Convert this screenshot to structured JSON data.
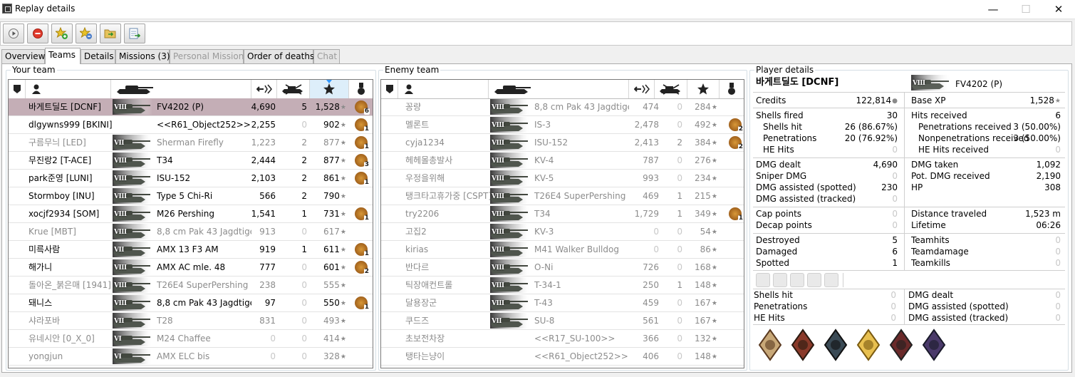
{
  "window": {
    "title": "Replay details",
    "minimize": "—",
    "maximize": "☐",
    "close": "✕"
  },
  "tabs": [
    {
      "label": "Overview",
      "state": "normal"
    },
    {
      "label": "Teams",
      "state": "active"
    },
    {
      "label": "Details",
      "state": "normal"
    },
    {
      "label": "Missions (3)",
      "state": "normal"
    },
    {
      "label": "Personal Mission",
      "state": "disabled"
    },
    {
      "label": "Order of deaths",
      "state": "normal"
    },
    {
      "label": "Chat",
      "state": "disabled"
    }
  ],
  "your_team": {
    "label": "Your team",
    "rows": [
      {
        "player": "바게트딜도 [DCNF]",
        "tier": "VIII",
        "tank": "FV4202 (P)",
        "dmg": "4,690",
        "kills": "5",
        "xp": "1,528",
        "medal": "6",
        "dim": false,
        "selected": true
      },
      {
        "player": "dlgywns999 [BKINI]",
        "tier": "",
        "tank": "<<R61_Object252>>",
        "dmg": "2,255",
        "kills": "0",
        "xp": "902",
        "medal": "1",
        "dim": false
      },
      {
        "player": "구름무늬 [LED]",
        "tier": "VII",
        "tank": "Sherman Firefly",
        "dmg": "1,223",
        "kills": "2",
        "xp": "877",
        "medal": "1",
        "dim": true
      },
      {
        "player": "무진랑2 [T-ACE]",
        "tier": "VIII",
        "tank": "T34",
        "dmg": "2,444",
        "kills": "2",
        "xp": "877",
        "medal": "3",
        "dim": false
      },
      {
        "player": "park준영 [LUNI]",
        "tier": "VIII",
        "tank": "ISU-152",
        "dmg": "2,103",
        "kills": "2",
        "xp": "861",
        "medal": "1",
        "dim": false
      },
      {
        "player": "Stormboy [INU]",
        "tier": "VIII",
        "tank": "Type 5 Chi-Ri",
        "dmg": "566",
        "kills": "2",
        "xp": "790",
        "medal": "",
        "dim": false
      },
      {
        "player": "xocjf2934 [SOM]",
        "tier": "VIII",
        "tank": "M26 Pershing",
        "dmg": "1,541",
        "kills": "1",
        "xp": "731",
        "medal": "1",
        "dim": false
      },
      {
        "player": "Krue [MBT]",
        "tier": "VIII",
        "tank": "8,8 cm Pak 43 Jagdtiger",
        "dmg": "913",
        "kills": "0",
        "xp": "617",
        "medal": "",
        "dim": true
      },
      {
        "player": "미륵사람",
        "tier": "VII",
        "tank": "AMX 13 F3 AM",
        "dmg": "919",
        "kills": "1",
        "xp": "611",
        "medal": "1",
        "dim": false
      },
      {
        "player": "해가니",
        "tier": "VIII",
        "tank": "AMX AC mle. 48",
        "dmg": "777",
        "kills": "0",
        "xp": "601",
        "medal": "2",
        "dim": false
      },
      {
        "player": "돌아온_붉은매 [1941]",
        "tier": "VIII",
        "tank": "T26E4 SuperPershing",
        "dmg": "238",
        "kills": "0",
        "xp": "555",
        "medal": "",
        "dim": true
      },
      {
        "player": "돼니스",
        "tier": "VIII",
        "tank": "8,8 cm Pak 43 Jagdtiger",
        "dmg": "97",
        "kills": "0",
        "xp": "550",
        "medal": "1",
        "dim": false
      },
      {
        "player": "샤라포바",
        "tier": "VII",
        "tank": "T28",
        "dmg": "831",
        "kills": "0",
        "xp": "493",
        "medal": "",
        "dim": true
      },
      {
        "player": "유네시안 [0_X_0]",
        "tier": "VI",
        "tank": "M24 Chaffee",
        "dmg": "0",
        "kills": "0",
        "xp": "414",
        "medal": "",
        "dim": true
      },
      {
        "player": "yongjun",
        "tier": "VI",
        "tank": "AMX ELC bis",
        "dmg": "0",
        "kills": "0",
        "xp": "328",
        "medal": "",
        "dim": true
      }
    ]
  },
  "enemy_team": {
    "label": "Enemy team",
    "rows": [
      {
        "player": "꽁량",
        "tier": "VIII",
        "tank": "8,8 cm Pak 43 Jagdtiger",
        "dmg": "474",
        "kills": "0",
        "xp": "284",
        "medal": "",
        "dim": true
      },
      {
        "player": "멜론트",
        "tier": "VIII",
        "tank": "IS-3",
        "dmg": "2,478",
        "kills": "0",
        "xp": "492",
        "medal": "2",
        "dim": true
      },
      {
        "player": "cyja1234",
        "tier": "VIII",
        "tank": "ISU-152",
        "dmg": "2,413",
        "kills": "2",
        "xp": "384",
        "medal": "2",
        "dim": true
      },
      {
        "player": "헤헤몰총발사",
        "tier": "VIII",
        "tank": "KV-4",
        "dmg": "787",
        "kills": "0",
        "xp": "276",
        "medal": "",
        "dim": true
      },
      {
        "player": "우정을위해",
        "tier": "VIII",
        "tank": "KV-5",
        "dmg": "993",
        "kills": "0",
        "xp": "234",
        "medal": "",
        "dim": true
      },
      {
        "player": "탱크타고휴가중 [CSPT]",
        "tier": "VIII",
        "tank": "T26E4 SuperPershing",
        "dmg": "469",
        "kills": "1",
        "xp": "215",
        "medal": "",
        "dim": true
      },
      {
        "player": "try2206",
        "tier": "VIII",
        "tank": "T34",
        "dmg": "1,729",
        "kills": "1",
        "xp": "349",
        "medal": "1",
        "dim": true
      },
      {
        "player": "고집2",
        "tier": "VIII",
        "tank": "KV-3",
        "dmg": "0",
        "kills": "0",
        "xp": "54",
        "medal": "",
        "dim": true
      },
      {
        "player": "kirias",
        "tier": "VIII",
        "tank": "M41 Walker Bulldog",
        "dmg": "0",
        "kills": "0",
        "xp": "86",
        "medal": "",
        "dim": true
      },
      {
        "player": "반다르",
        "tier": "VIII",
        "tank": "O-Ni",
        "dmg": "726",
        "kills": "0",
        "xp": "168",
        "medal": "",
        "dim": true
      },
      {
        "player": "틱장애컨트롤",
        "tier": "VIII",
        "tank": "T-34-1",
        "dmg": "250",
        "kills": "1",
        "xp": "148",
        "medal": "",
        "dim": true
      },
      {
        "player": "달용장군",
        "tier": "VIII",
        "tank": "T-43",
        "dmg": "459",
        "kills": "0",
        "xp": "167",
        "medal": "",
        "dim": true
      },
      {
        "player": "쿠드즈",
        "tier": "VII",
        "tank": "SU-8",
        "dmg": "561",
        "kills": "0",
        "xp": "167",
        "medal": "",
        "dim": true
      },
      {
        "player": "초보전차장",
        "tier": "",
        "tank": "<<R17_SU-100>>",
        "dmg": "366",
        "kills": "0",
        "xp": "132",
        "medal": "",
        "dim": true
      },
      {
        "player": "탱타는냥이",
        "tier": "",
        "tank": "<<R61_Object252>>",
        "dmg": "406",
        "kills": "0",
        "xp": "148",
        "medal": "",
        "dim": true
      }
    ]
  },
  "player_details": {
    "label": "Player details",
    "name": "바게트딜도 [DCNF]",
    "tier": "VIII",
    "tank": "FV4202 (P)",
    "credits": {
      "label": "Credits",
      "value": "122,814"
    },
    "base_xp": {
      "label": "Base XP",
      "value": "1,528"
    },
    "left1": [
      {
        "label": "Shells fired",
        "value": "30",
        "indent": false
      },
      {
        "label": "Shells hit",
        "value": "26 (86.67%)",
        "indent": true
      },
      {
        "label": "Penetrations",
        "value": "20 (76.92%)",
        "indent": true
      },
      {
        "label": "HE Hits",
        "value": "0",
        "indent": true
      }
    ],
    "right1": [
      {
        "label": "Hits received",
        "value": "6",
        "indent": false
      },
      {
        "label": "Penetrations received",
        "value": "3 (50.00%)",
        "indent": true
      },
      {
        "label": "Nonpenetrations received",
        "value": "3 (50.00%)",
        "indent": true
      },
      {
        "label": "HE Hits received",
        "value": "0",
        "indent": true
      }
    ],
    "left2": [
      {
        "label": "DMG dealt",
        "value": "4,690"
      },
      {
        "label": "Sniper DMG",
        "value": "0"
      },
      {
        "label": "DMG assisted (spotted)",
        "value": "230"
      },
      {
        "label": "DMG assisted (tracked)",
        "value": "0"
      }
    ],
    "right2": [
      {
        "label": "DMG taken",
        "value": "1,092"
      },
      {
        "label": "Pot. DMG received",
        "value": "2,190"
      },
      {
        "label": "HP",
        "value": "308"
      }
    ],
    "left3": [
      {
        "label": "Cap points",
        "value": "0"
      },
      {
        "label": "Decap points",
        "value": "0"
      }
    ],
    "right3": [
      {
        "label": "Distance traveled",
        "value": "1,523 m"
      },
      {
        "label": "Lifetime",
        "value": "06:26"
      }
    ],
    "left4": [
      {
        "label": "Destroyed",
        "value": "5"
      },
      {
        "label": "Damaged",
        "value": "6"
      },
      {
        "label": "Spotted",
        "value": "1"
      }
    ],
    "right4": [
      {
        "label": "Teamhits",
        "value": "0"
      },
      {
        "label": "Teamdamage",
        "value": "0"
      },
      {
        "label": "Teamkills",
        "value": "0"
      }
    ],
    "left5": [
      {
        "label": "Shells hit",
        "value": "0"
      },
      {
        "label": "Penetrations",
        "value": "0"
      },
      {
        "label": "HE Hits",
        "value": "0"
      }
    ],
    "right5": [
      {
        "label": "DMG dealt",
        "value": "0"
      },
      {
        "label": "DMG assisted (spotted)",
        "value": "0"
      },
      {
        "label": "DMG assisted (tracked)",
        "value": "0"
      }
    ]
  },
  "colors": {
    "selected_row": "#c4aeb6",
    "dim_text": "#8c8c8c",
    "zero_text": "#c8c8c8",
    "accent": "#3399ff"
  }
}
